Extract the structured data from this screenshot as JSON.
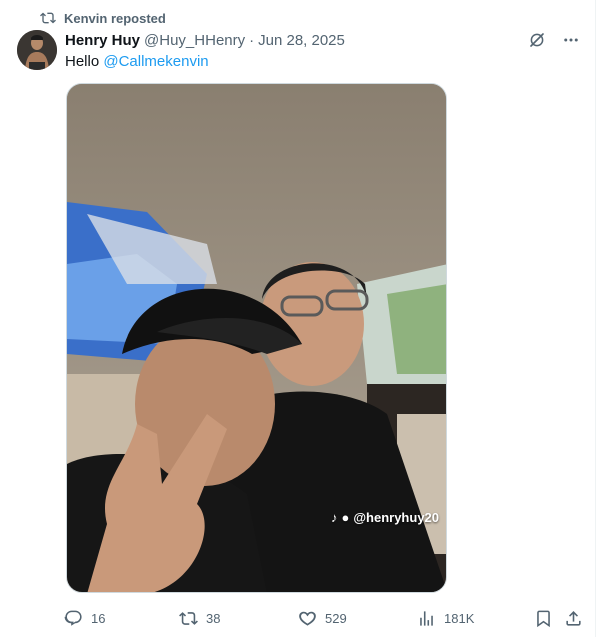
{
  "repost": {
    "label": "Kenvin reposted"
  },
  "post": {
    "author_name": "Henry Huy",
    "handle": "@Huy_HHenry",
    "separator": "·",
    "date": "Jun 28, 2025",
    "text": "Hello",
    "mention": "@Callmekenvin",
    "media_watermark": "@henryhuy20"
  },
  "actions": {
    "replies": "16",
    "reposts": "38",
    "likes": "529",
    "views": "181K"
  },
  "colors": {
    "accent": "#1d9bf0",
    "muted": "#536471",
    "text": "#0f1419"
  },
  "icons": {
    "repost": "repost-icon",
    "grok": "grok-icon",
    "more": "more-icon",
    "reply": "reply-icon",
    "like": "heart-icon",
    "views": "views-icon",
    "bookmark": "bookmark-icon",
    "share": "share-icon"
  }
}
